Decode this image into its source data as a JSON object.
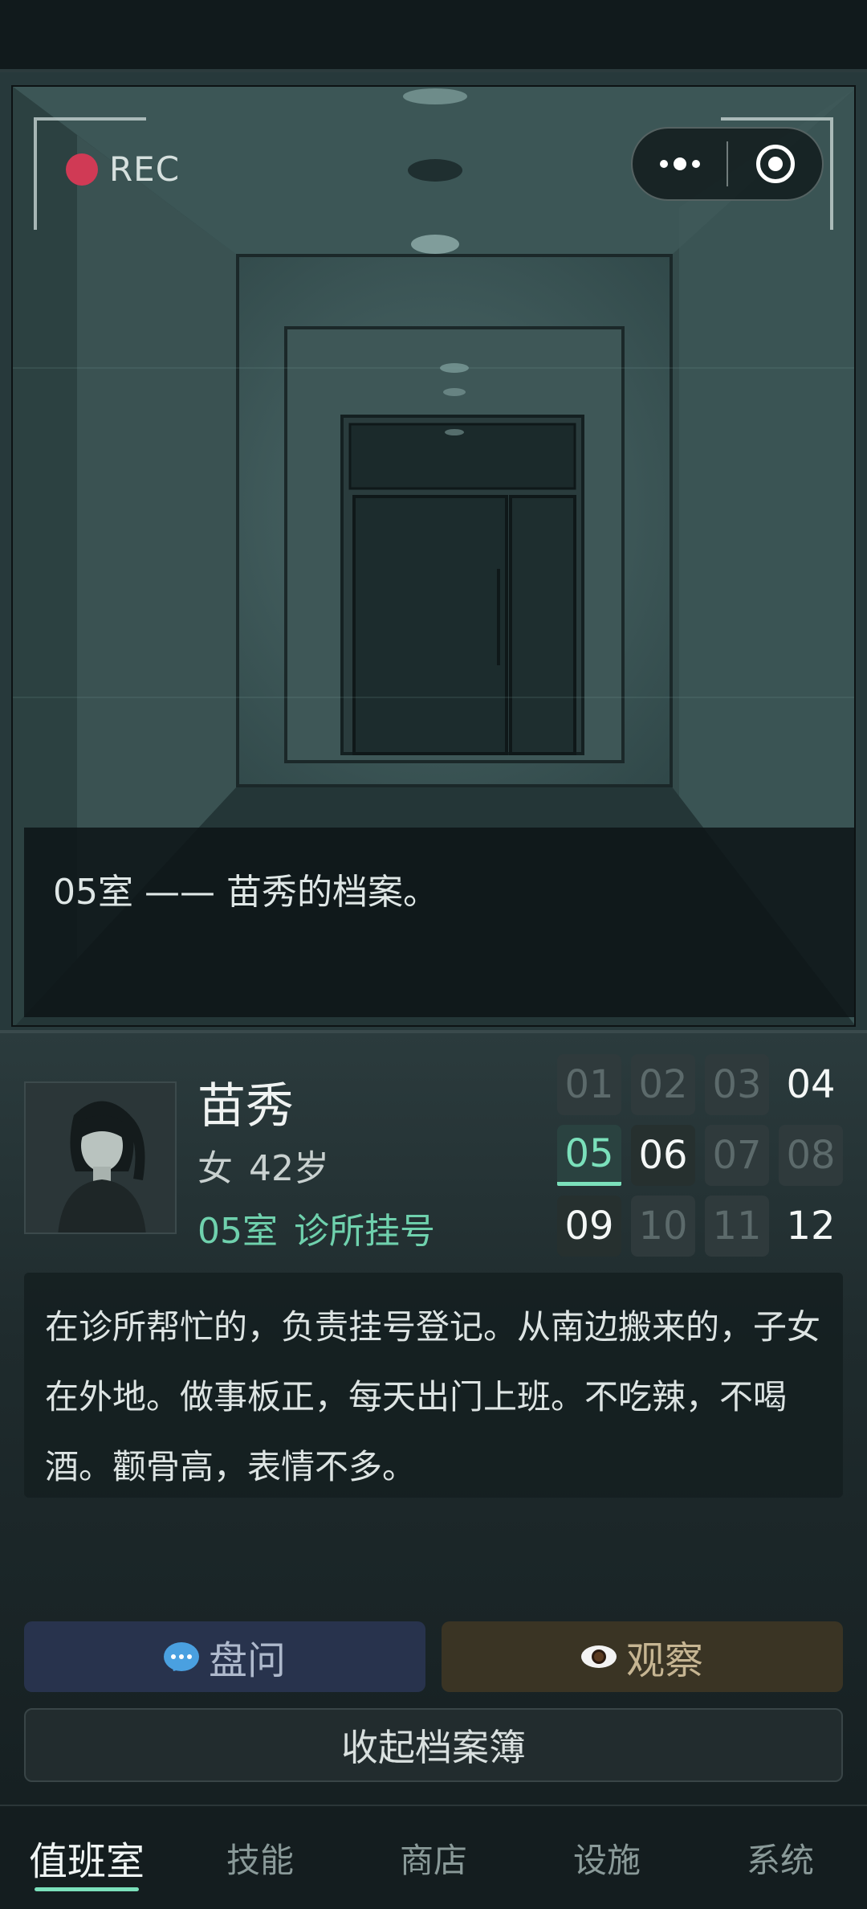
{
  "camera": {
    "rec_label": "REC",
    "caption": "05室 —— 苗秀的档案。"
  },
  "resident": {
    "name": "苗秀",
    "gender": "女",
    "age": "42岁",
    "room": "05室",
    "job": "诊所挂号",
    "description": "在诊所帮忙的，负责挂号登记。从南边搬来的，子女在外地。做事板正，每天出门上班。不吃辣，不喝酒。颧骨高，表情不多。"
  },
  "rooms": [
    {
      "label": "01",
      "state": "dim"
    },
    {
      "label": "02",
      "state": "dim"
    },
    {
      "label": "03",
      "state": "dim"
    },
    {
      "label": "04",
      "state": "bright"
    },
    {
      "label": "05",
      "state": "sel"
    },
    {
      "label": "06",
      "state": "on"
    },
    {
      "label": "07",
      "state": "dim"
    },
    {
      "label": "08",
      "state": "dim"
    },
    {
      "label": "09",
      "state": "on"
    },
    {
      "label": "10",
      "state": "dim"
    },
    {
      "label": "11",
      "state": "dim"
    },
    {
      "label": "12",
      "state": "bright"
    }
  ],
  "actions": {
    "ask_label": "盘问",
    "observe_label": "观察",
    "collapse_label": "收起档案簿"
  },
  "nav": {
    "tabs": [
      "值班室",
      "技能",
      "商店",
      "设施",
      "系统"
    ],
    "active_index": 0
  },
  "colors": {
    "accent": "#7be0bb",
    "rec": "#d03a55"
  }
}
